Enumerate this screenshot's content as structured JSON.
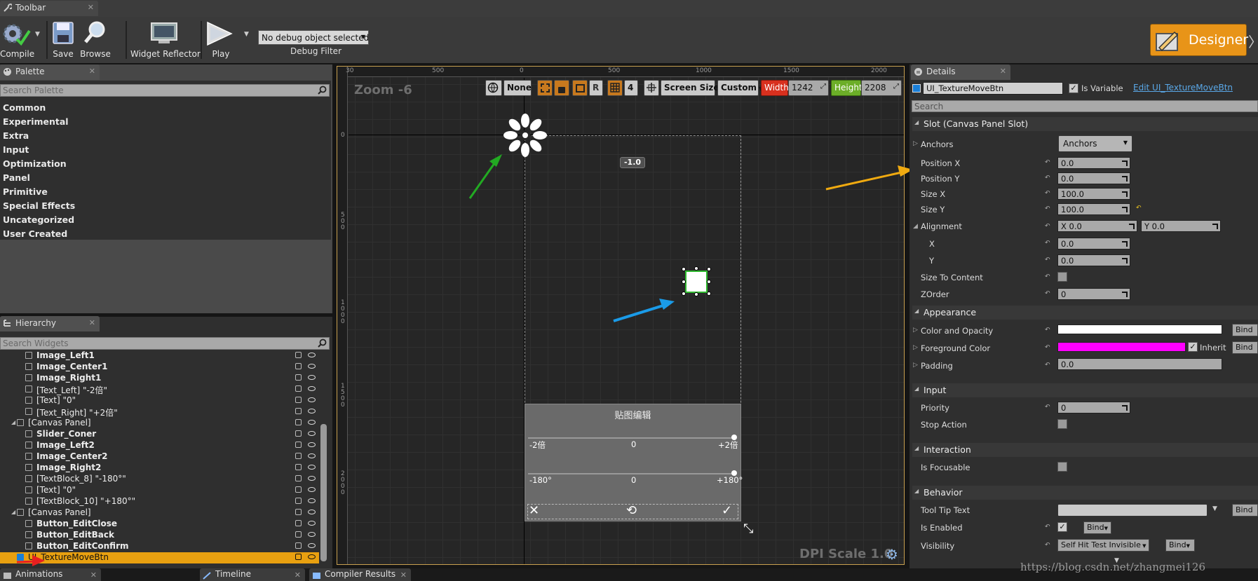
{
  "toolbar": {
    "tab_label": "Toolbar",
    "buttons": [
      {
        "id": "compile",
        "label": "Compile"
      },
      {
        "id": "save",
        "label": "Save"
      },
      {
        "id": "browse",
        "label": "Browse"
      },
      {
        "id": "widget_reflector",
        "label": "Widget Reflector"
      },
      {
        "id": "play",
        "label": "Play"
      }
    ],
    "debug_select": "No debug object selected",
    "debug_filter_label": "Debug Filter",
    "designer_label": "Designer",
    "accent": "#f0a020"
  },
  "palette": {
    "tab_label": "Palette",
    "search_placeholder": "Search Palette",
    "items": [
      "Common",
      "Experimental",
      "Extra",
      "Input",
      "Optimization",
      "Panel",
      "Primitive",
      "Special Effects",
      "Uncategorized",
      "User Created"
    ]
  },
  "hierarchy": {
    "tab_label": "Hierarchy",
    "search_placeholder": "Search Widgets",
    "rows": [
      {
        "label": "Image_Left1",
        "bold": true
      },
      {
        "label": "Image_Center1",
        "bold": true
      },
      {
        "label": "Image_Right1",
        "bold": true
      },
      {
        "label": "[Text_Left] \"-2倍\"",
        "bold": false
      },
      {
        "label": "[Text] \"0\"",
        "bold": false
      },
      {
        "label": "[Text_Right] \"+2倍\"",
        "bold": false
      },
      {
        "label": "[Canvas Panel]",
        "bold": false
      },
      {
        "label": "Slider_Coner",
        "bold": true
      },
      {
        "label": "Image_Left2",
        "bold": true
      },
      {
        "label": "Image_Center2",
        "bold": true
      },
      {
        "label": "Image_Right2",
        "bold": true
      },
      {
        "label": "[TextBlock_8] \"-180°\"",
        "bold": false
      },
      {
        "label": "[Text] \"0\"",
        "bold": false
      },
      {
        "label": "[TextBlock_10] \"+180°\"",
        "bold": false
      },
      {
        "label": "[Canvas Panel]",
        "bold": false
      },
      {
        "label": "Button_EditClose",
        "bold": true
      },
      {
        "label": "Button_EditBack",
        "bold": true
      },
      {
        "label": "Button_EditConfirm",
        "bold": true
      },
      {
        "label": "UI_TextureMoveBtn",
        "bold": false,
        "selected": true
      }
    ]
  },
  "bottom_tabs": [
    "Animations",
    "Timeline",
    "Compiler Results"
  ],
  "canvas": {
    "zoom": "Zoom -6",
    "dpi": "DPI Scale 1.0",
    "ruler_top": [
      "30",
      "500",
      "0",
      "500",
      "1000",
      "1500",
      "2000"
    ],
    "ruler_left": [
      "0",
      "5\n0\n0",
      "1\n0\n0\n0",
      "1\n5\n0\n0",
      "2\n0\n0\n0"
    ],
    "toolbar": {
      "none": "None",
      "r": "R",
      "grid": "4",
      "screen_size": "Screen Size",
      "custom": "Custom",
      "width_label": "Width",
      "width_value": "1242",
      "height_label": "Height",
      "height_value": "2208"
    },
    "anchor_tag": "-1.0",
    "panel_title": "贴图编辑",
    "slider1": {
      "left": "-2倍",
      "mid": "0",
      "right": "+2倍"
    },
    "slider2": {
      "left": "-180°",
      "mid": "0",
      "right": "+180°"
    }
  },
  "details": {
    "tab_label": "Details",
    "name": "UI_TextureMoveBtn",
    "is_variable": "Is Variable",
    "edit_link": "Edit UI_TextureMoveBtn",
    "search_placeholder": "Search",
    "sections": {
      "slot": "Slot (Canvas Panel Slot)",
      "appearance": "Appearance",
      "input": "Input",
      "interaction": "Interaction",
      "behavior": "Behavior"
    },
    "slot": {
      "anchors_label": "Anchors",
      "anchors_value": "Anchors",
      "position_x_label": "Position X",
      "position_x": "0.0",
      "position_y_label": "Position Y",
      "position_y": "0.0",
      "size_x_label": "Size X",
      "size_x": "100.0",
      "size_y_label": "Size Y",
      "size_y": "100.0",
      "alignment_label": "Alignment",
      "alignment_x": "X  0.0",
      "alignment_y": "Y  0.0",
      "x_label": "X",
      "x_value": "0.0",
      "y_label": "Y",
      "y_value": "0.0",
      "size_to_content": "Size To Content",
      "zorder_label": "ZOrder",
      "zorder": "0"
    },
    "appearance": {
      "color_opacity": "Color and Opacity",
      "foreground": "Foreground Color",
      "foreground_color": "#ff00ff",
      "inherit": "Inherit",
      "padding_label": "Padding",
      "padding": "0.0",
      "bind": "Bind"
    },
    "input": {
      "priority_label": "Priority",
      "priority": "0",
      "stop_action": "Stop Action"
    },
    "interaction": {
      "is_focusable": "Is Focusable"
    },
    "behavior": {
      "tooltip": "Tool Tip Text",
      "enabled": "Is Enabled",
      "visibility": "Visibility",
      "visibility_value": "Self Hit Test Invisible",
      "bind": "Bind"
    }
  },
  "watermark": "https://blog.csdn.net/zhangmei126"
}
